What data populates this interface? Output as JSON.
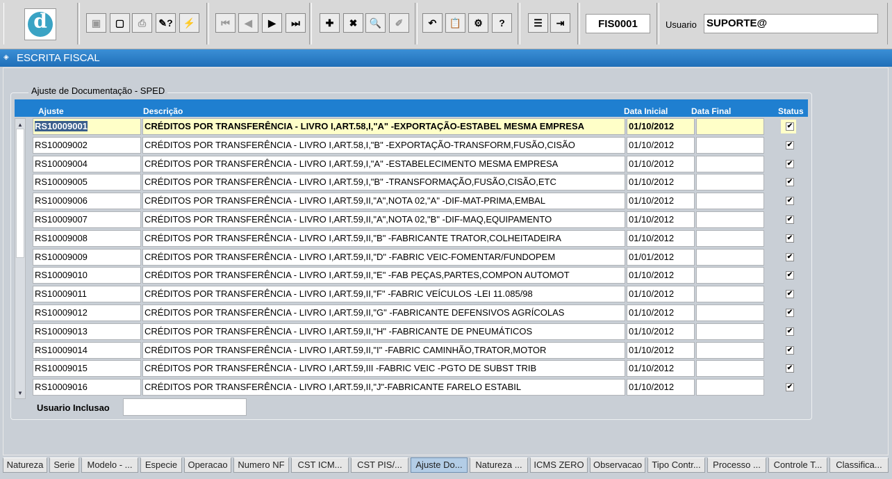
{
  "toolbar": {
    "form_code": "FIS0001",
    "user_label": "Usuario",
    "user_value": "SUPORTE@",
    "buttons": [
      {
        "name": "save-icon",
        "glyph": "▣",
        "disabled": true
      },
      {
        "name": "screen-icon",
        "glyph": "▢",
        "disabled": false
      },
      {
        "name": "print-icon",
        "glyph": "⎙",
        "disabled": true
      },
      {
        "name": "query-icon",
        "glyph": "✎?",
        "disabled": false
      },
      {
        "name": "execute-query-icon",
        "glyph": "⚡",
        "disabled": false
      },
      {
        "name": "first-record-icon",
        "glyph": "⏮",
        "disabled": true
      },
      {
        "name": "previous-record-icon",
        "glyph": "◀",
        "disabled": true
      },
      {
        "name": "next-record-icon",
        "glyph": "▶",
        "disabled": false
      },
      {
        "name": "last-record-icon",
        "glyph": "⏭",
        "disabled": false
      },
      {
        "name": "insert-record-icon",
        "glyph": "✚",
        "disabled": false
      },
      {
        "name": "delete-record-icon",
        "glyph": "✖",
        "disabled": false
      },
      {
        "name": "find-icon",
        "glyph": "🔍",
        "disabled": false
      },
      {
        "name": "edit-icon",
        "glyph": "✐",
        "disabled": true
      },
      {
        "name": "undo-icon",
        "glyph": "↶",
        "disabled": false
      },
      {
        "name": "clipboard-icon",
        "glyph": "📋",
        "disabled": true
      },
      {
        "name": "settings-icon",
        "glyph": "⚙",
        "disabled": false
      },
      {
        "name": "help-icon",
        "glyph": "?",
        "disabled": false
      },
      {
        "name": "menu-icon",
        "glyph": "☰",
        "disabled": false
      },
      {
        "name": "exit-icon",
        "glyph": "⇥",
        "disabled": false
      }
    ]
  },
  "title": "ESCRITA FISCAL",
  "section": {
    "title": "Ajuste de Documentação - SPED",
    "columns": {
      "ajuste": "Ajuste",
      "descricao": "Descrição",
      "data_inicial": "Data Inicial",
      "data_final": "Data Final",
      "status": "Status"
    },
    "rows": [
      {
        "ajuste": "RS10009001",
        "descricao": "CRÉDITOS POR TRANSFERÊNCIA - LIVRO I,ART.58,I,\"A\" -EXPORTAÇÃO-ESTABEL MESMA EMPRESA",
        "data_inicial": "01/10/2012",
        "data_final": "",
        "status": "✔"
      },
      {
        "ajuste": "RS10009002",
        "descricao": "CRÉDITOS POR TRANSFERÊNCIA - LIVRO I,ART.58,I,\"B\" -EXPORTAÇÃO-TRANSFORM,FUSÃO,CISÃO",
        "data_inicial": "01/10/2012",
        "data_final": "",
        "status": "✔"
      },
      {
        "ajuste": "RS10009004",
        "descricao": "CRÉDITOS POR TRANSFERÊNCIA - LIVRO I,ART.59,I,\"A\" -ESTABELECIMENTO MESMA EMPRESA",
        "data_inicial": "01/10/2012",
        "data_final": "",
        "status": "✔"
      },
      {
        "ajuste": "RS10009005",
        "descricao": "CRÉDITOS POR TRANSFERÊNCIA - LIVRO I,ART.59,I,\"B\" -TRANSFORMAÇÃO,FUSÃO,CISÃO,ETC",
        "data_inicial": "01/10/2012",
        "data_final": "",
        "status": "✔"
      },
      {
        "ajuste": "RS10009006",
        "descricao": "CRÉDITOS POR TRANSFERÊNCIA - LIVRO I,ART.59,II,\"A\",NOTA 02,\"A\" -DIF-MAT-PRIMA,EMBAL",
        "data_inicial": "01/10/2012",
        "data_final": "",
        "status": "✔"
      },
      {
        "ajuste": "RS10009007",
        "descricao": "CRÉDITOS POR TRANSFERÊNCIA - LIVRO I,ART.59,II,\"A\",NOTA 02,\"B\" -DIF-MAQ,EQUIPAMENTO",
        "data_inicial": "01/10/2012",
        "data_final": "",
        "status": "✔"
      },
      {
        "ajuste": "RS10009008",
        "descricao": "CRÉDITOS POR TRANSFERÊNCIA - LIVRO I,ART.59,II,\"B\" -FABRICANTE TRATOR,COLHEITADEIRA",
        "data_inicial": "01/10/2012",
        "data_final": "",
        "status": "✔"
      },
      {
        "ajuste": "RS10009009",
        "descricao": "CRÉDITOS POR TRANSFERÊNCIA - LIVRO I,ART.59,II,\"D\" -FABRIC VEIC-FOMENTAR/FUNDOPEM",
        "data_inicial": "01/01/2012",
        "data_final": "",
        "status": "✔"
      },
      {
        "ajuste": "RS10009010",
        "descricao": "CRÉDITOS POR TRANSFERÊNCIA - LIVRO I,ART.59,II,\"E\" -FAB PEÇAS,PARTES,COMPON AUTOMOT",
        "data_inicial": "01/10/2012",
        "data_final": "",
        "status": "✔"
      },
      {
        "ajuste": "RS10009011",
        "descricao": "CRÉDITOS POR TRANSFERÊNCIA - LIVRO I,ART.59,II,\"F\" -FABRIC VEÍCULOS -LEI 11.085/98",
        "data_inicial": "01/10/2012",
        "data_final": "",
        "status": "✔"
      },
      {
        "ajuste": "RS10009012",
        "descricao": "CRÉDITOS POR TRANSFERÊNCIA - LIVRO I,ART.59,II,\"G\" -FABRICANTE DEFENSIVOS AGRÍCOLAS",
        "data_inicial": "01/10/2012",
        "data_final": "",
        "status": "✔"
      },
      {
        "ajuste": "RS10009013",
        "descricao": "CRÉDITOS POR TRANSFERÊNCIA - LIVRO I,ART.59,II,\"H\" -FABRICANTE DE PNEUMÁTICOS",
        "data_inicial": "01/10/2012",
        "data_final": "",
        "status": "✔"
      },
      {
        "ajuste": "RS10009014",
        "descricao": "CRÉDITOS POR TRANSFERÊNCIA - LIVRO I,ART.59,II,\"I\" -FABRIC CAMINHÃO,TRATOR,MOTOR",
        "data_inicial": "01/10/2012",
        "data_final": "",
        "status": "✔"
      },
      {
        "ajuste": "RS10009015",
        "descricao": "CRÉDITOS POR TRANSFERÊNCIA - LIVRO I,ART.59,III -FABRIC VEIC -PGTO DE SUBST TRIB",
        "data_inicial": "01/10/2012",
        "data_final": "",
        "status": "✔"
      },
      {
        "ajuste": "RS10009016",
        "descricao": "CRÉDITOS POR TRANSFERÊNCIA - LIVRO I,ART.59,II,\"J\"-FABRICANTE FARELO ESTABIL",
        "data_inicial": "01/10/2012",
        "data_final": "",
        "status": "✔"
      }
    ],
    "usuario_inclusao_label": "Usuario Inclusao",
    "usuario_inclusao_value": ""
  },
  "tabs": [
    {
      "label": "Natureza",
      "active": false
    },
    {
      "label": "Serie",
      "active": false
    },
    {
      "label": "Modelo - ...",
      "active": false
    },
    {
      "label": "Especie",
      "active": false
    },
    {
      "label": "Operacao",
      "active": false
    },
    {
      "label": "Numero NF",
      "active": false
    },
    {
      "label": "CST ICM...",
      "active": false
    },
    {
      "label": "CST PIS/...",
      "active": false
    },
    {
      "label": "Ajuste Do...",
      "active": true
    },
    {
      "label": "Natureza ...",
      "active": false
    },
    {
      "label": "ICMS ZERO",
      "active": false
    },
    {
      "label": "Observacao",
      "active": false
    },
    {
      "label": "Tipo Contr...",
      "active": false
    },
    {
      "label": "Processo ...",
      "active": false
    },
    {
      "label": "Controle T...",
      "active": false
    },
    {
      "label": "Classifica...",
      "active": false
    }
  ]
}
